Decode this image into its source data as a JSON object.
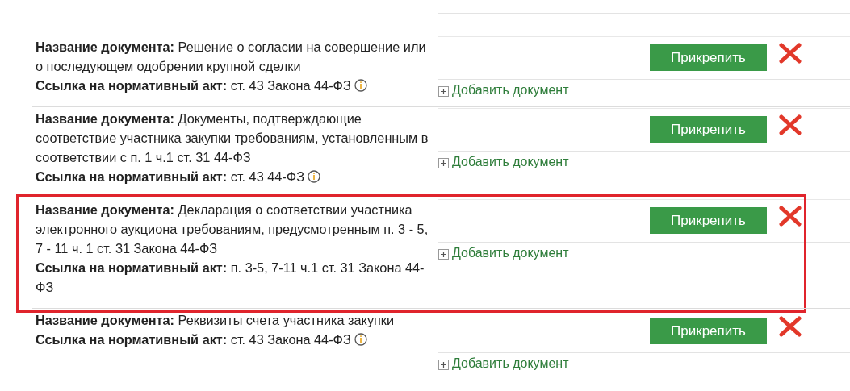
{
  "documents": [
    {
      "name_label": "Название документа:",
      "name": "Решение о согласии на совершение или о последующем одобрении крупной сделки",
      "act_label": "Ссылка на нормативный акт:",
      "act": "ст. 43 Закона 44-ФЗ",
      "info": true,
      "highlighted": false,
      "attach_button": "Прикрепить",
      "add_link": "Добавить документ"
    },
    {
      "name_label": "Название документа:",
      "name": " Документы, подтверждающие соответствие участника закупки требованиям, установленным в соответствии с п. 1 ч.1 ст. 31 44-ФЗ",
      "act_label": "Ссылка на нормативный акт:",
      "act": "ст. 43 44-ФЗ",
      "info": true,
      "highlighted": false,
      "attach_button": "Прикрепить",
      "add_link": "Добавить документ"
    },
    {
      "name_label": "Название документа:",
      "name": "Декларация о соответствии участника электронного аукциона требованиям, предусмотренным п. 3 - 5, 7 - 11 ч. 1 ст. 31 Закона 44-ФЗ",
      "act_label": "Ссылка на нормативный акт:",
      "act": "п. 3-5, 7-11 ч.1 ст. 31 Закона 44-ФЗ",
      "info": false,
      "highlighted": true,
      "attach_button": "Прикрепить",
      "add_link": "Добавить документ"
    },
    {
      "name_label": "Название документа:",
      "name": "Реквизиты счета участника закупки",
      "act_label": "Ссылка на нормативный акт:",
      "act": "ст. 43 Закона 44-ФЗ",
      "info": true,
      "highlighted": false,
      "attach_button": "Прикрепить",
      "add_link": "Добавить документ"
    }
  ]
}
